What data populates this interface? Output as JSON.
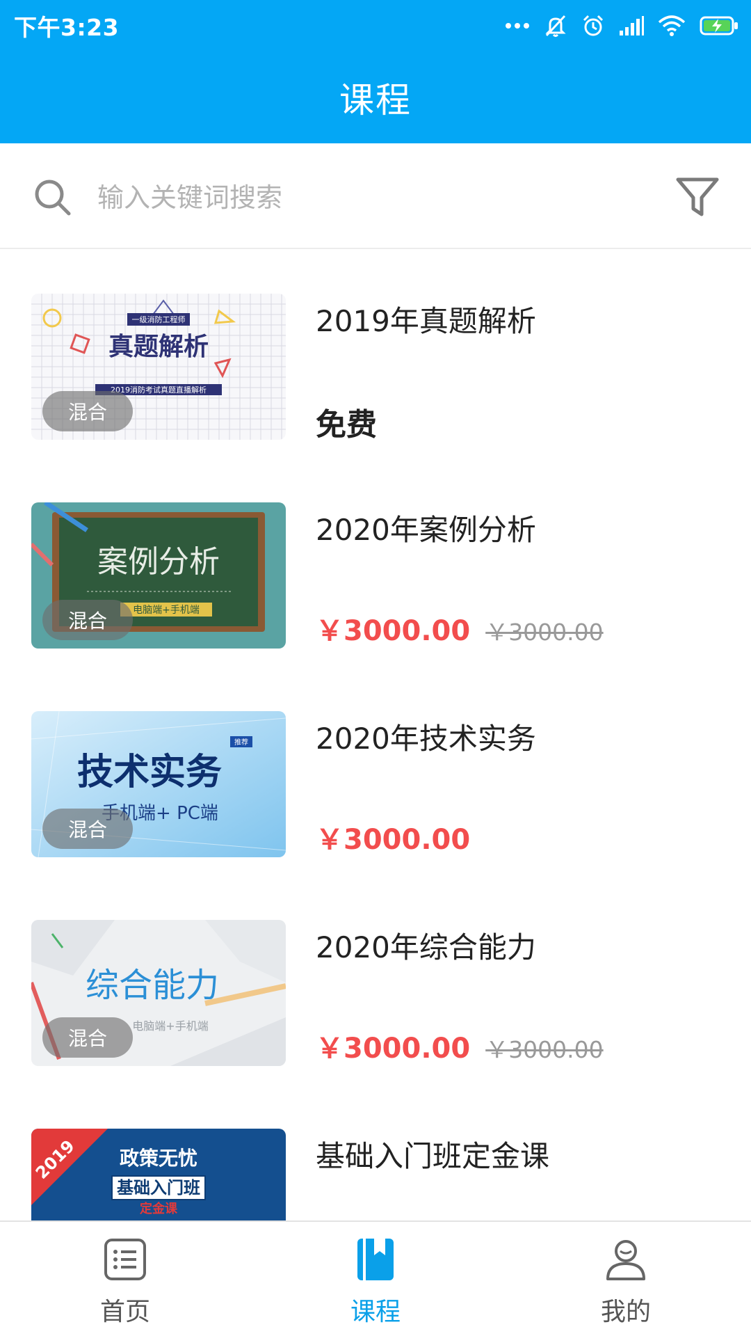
{
  "status_bar": {
    "time": "下午3:23",
    "icons": [
      "more-dots-icon",
      "mute-icon",
      "alarm-icon",
      "signal-icon",
      "wifi-icon",
      "battery-charging-icon"
    ]
  },
  "header": {
    "title": "课程"
  },
  "search": {
    "placeholder": "输入关键词搜索",
    "value": ""
  },
  "colors": {
    "header_bg": "#04a7f5",
    "price_red": "#f24d4d",
    "active_tab": "#0aa0e9",
    "badge_bg": "rgba(110,110,110,0.62)"
  },
  "courses": [
    {
      "title": "2019年真题解析",
      "type_badge": "混合",
      "price": "免费",
      "thumb_text": {
        "tag": "一级消防工程师",
        "main": "真题解析",
        "sub": "2019消防考试真题直播解析"
      }
    },
    {
      "title": "2020年案例分析",
      "type_badge": "混合",
      "price": "￥3000.00",
      "original_price": "￥3000.00",
      "thumb_text": {
        "main": "案例分析",
        "sub": "电脑端+手机端"
      }
    },
    {
      "title": "2020年技术实务",
      "type_badge": "混合",
      "price": "￥3000.00",
      "thumb_text": {
        "tag": "推荐",
        "main": "技术实务",
        "sub": "手机端+ PC端"
      }
    },
    {
      "title": "2020年综合能力",
      "type_badge": "混合",
      "price": "￥3000.00",
      "original_price": "￥3000.00",
      "thumb_text": {
        "main": "综合能力",
        "sub": "电脑端+手机端"
      }
    },
    {
      "title": "基础入门班定金课",
      "thumb_text": {
        "year": "2019",
        "main": "政策无忧",
        "sub": "基础入门班",
        "tag": "定金课"
      }
    }
  ],
  "tabbar": {
    "tabs": [
      {
        "label": "首页",
        "icon": "list-icon",
        "active": false
      },
      {
        "label": "课程",
        "icon": "bookmark-book-icon",
        "active": true
      },
      {
        "label": "我的",
        "icon": "user-icon",
        "active": false
      }
    ]
  }
}
